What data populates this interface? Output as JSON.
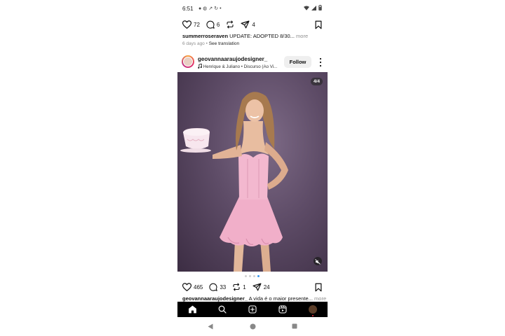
{
  "status_bar": {
    "time": "6:51",
    "notification_icons": [
      "chat-icon",
      "settings-icon",
      "missed-call-icon",
      "refresh-icon",
      "dot-icon"
    ],
    "system_icons": [
      "wifi-icon",
      "signal-icon",
      "battery-icon"
    ]
  },
  "previous_post": {
    "likes": "72",
    "comments": "6",
    "shares": "4",
    "caption_user": "summerroseraven",
    "caption_text": " UPDATE: ADOPTED 8/30...",
    "caption_more": " more",
    "timestamp": "6 days ago",
    "separator": "•",
    "see_translation": "See translation"
  },
  "post": {
    "username": "geovannaaraujodesigner_",
    "music": "Henrique & Juliano • Discurso (Ao Vi...",
    "follow_label": "Follow",
    "image_counter": "4/4",
    "carousel": {
      "count": 4,
      "active": 4
    },
    "likes": "465",
    "comments": "33",
    "reposts": "1",
    "shares": "24",
    "caption_user": "geovannaaraujodesigner_",
    "caption_text": " A vida é o maior presente...",
    "caption_more": " more"
  },
  "bottom_nav": [
    "home-icon",
    "search-icon",
    "create-icon",
    "reels-icon",
    "profile-avatar"
  ],
  "colors": {
    "accent_blue": "#3897f0",
    "notification_red": "#ff3040",
    "follow_bg": "#efefef",
    "nav_bg": "#000000"
  }
}
